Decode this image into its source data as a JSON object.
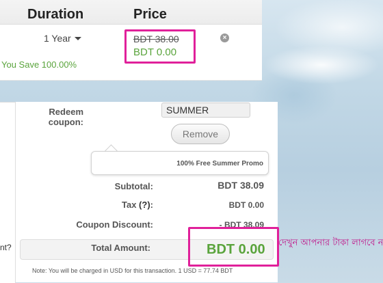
{
  "table": {
    "duration_header": "Duration",
    "price_header": "Price",
    "duration_value": "1 Year",
    "old_price": "BDT 38.00",
    "new_price": "BDT 0.00",
    "you_save": "You Save 100.00%",
    "remove_icon": "close-circle-icon"
  },
  "coupon": {
    "label_line1": "Redeem",
    "label_line2": "coupon:",
    "value": "SUMMER",
    "remove_label": "Remove",
    "promo_text": "100% Free Summer Promo"
  },
  "summary": {
    "subtotal_label": "Subtotal:",
    "subtotal_value": "BDT 38.09",
    "tax_label": "Tax",
    "tax_help": "(?)",
    "tax_colon": ":",
    "tax_value": "BDT 0.00",
    "discount_label": "Coupon Discount:",
    "discount_value": "- BDT 38.09",
    "total_label": "Total Amount:",
    "total_value": "BDT 0.00",
    "note": "Note: You will be charged in USD for this transaction. 1 USD = 77.74 BDT"
  },
  "side": {
    "truncated_text": "nt?"
  },
  "annotation": {
    "text": "দেখুন আপনার টাকা লাগবে না"
  },
  "colors": {
    "highlight": "#e0209a",
    "green": "#5aa43c"
  }
}
